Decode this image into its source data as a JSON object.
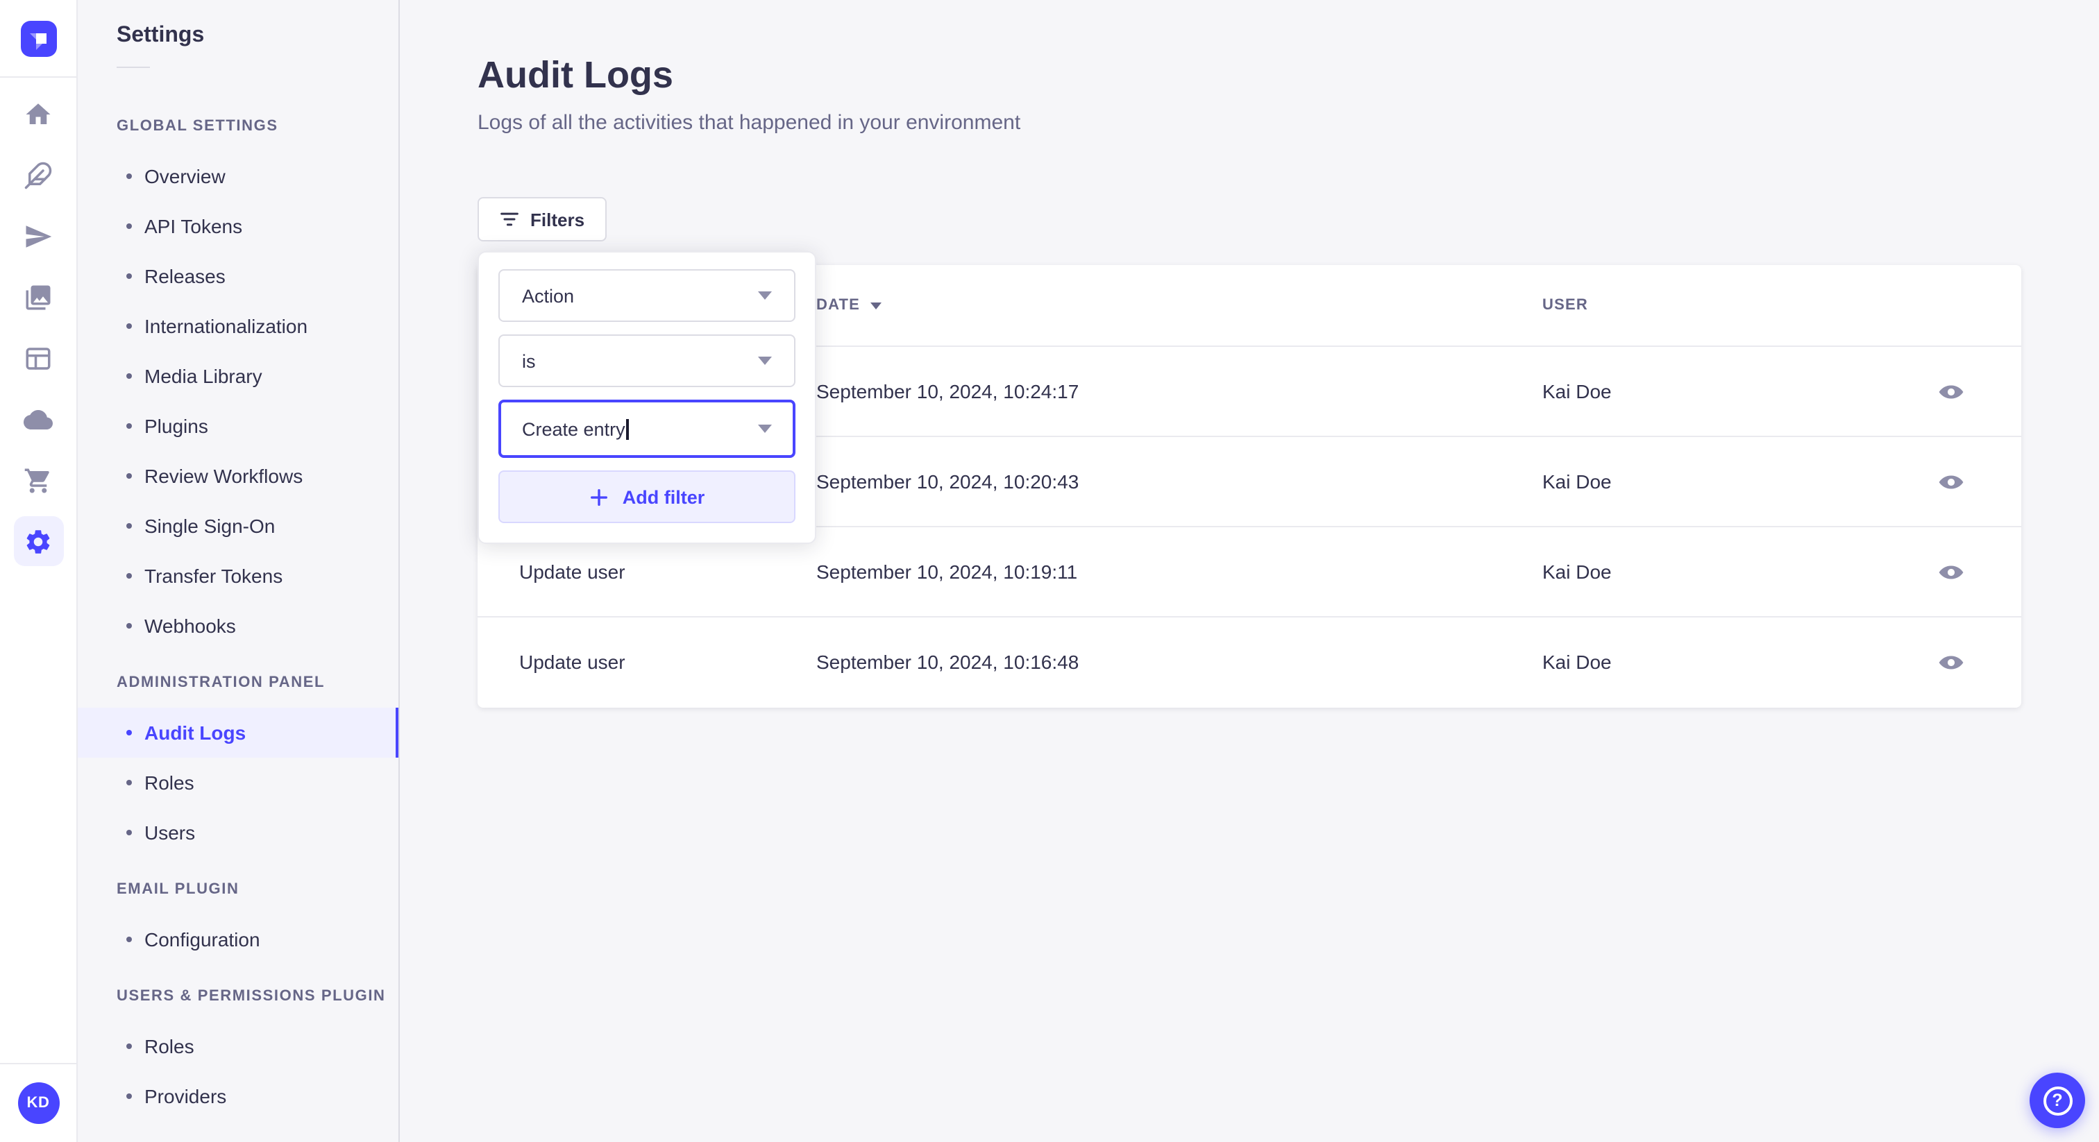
{
  "colors": {
    "primary": "#4945ff",
    "primary_light_bg": "#f0f0ff",
    "text_dark": "#32324d",
    "text_muted": "#666687",
    "icon_gray": "#8e8ea9",
    "border": "#dcdce4",
    "border_light": "#eaeaef",
    "page_bg": "#f6f6f9",
    "card_bg": "#ffffff"
  },
  "rail": {
    "logo_icon": "strapi-logo",
    "items": [
      {
        "icon": "home-icon",
        "active": false
      },
      {
        "icon": "feather-icon",
        "active": false
      },
      {
        "icon": "paper-plane-icon",
        "active": false
      },
      {
        "icon": "media-library-icon",
        "active": false
      },
      {
        "icon": "layout-icon",
        "active": false
      },
      {
        "icon": "cloud-icon",
        "active": false
      },
      {
        "icon": "cart-icon",
        "active": false
      },
      {
        "icon": "gear-icon",
        "active": true
      }
    ],
    "avatar": {
      "initials": "KD"
    }
  },
  "sidebar": {
    "title": "Settings",
    "sections": [
      {
        "label": "GLOBAL SETTINGS",
        "items": [
          {
            "label": "Overview",
            "active": false
          },
          {
            "label": "API Tokens",
            "active": false
          },
          {
            "label": "Releases",
            "active": false
          },
          {
            "label": "Internationalization",
            "active": false
          },
          {
            "label": "Media Library",
            "active": false
          },
          {
            "label": "Plugins",
            "active": false
          },
          {
            "label": "Review Workflows",
            "active": false
          },
          {
            "label": "Single Sign-On",
            "active": false
          },
          {
            "label": "Transfer Tokens",
            "active": false
          },
          {
            "label": "Webhooks",
            "active": false
          }
        ]
      },
      {
        "label": "ADMINISTRATION PANEL",
        "items": [
          {
            "label": "Audit Logs",
            "active": true
          },
          {
            "label": "Roles",
            "active": false
          },
          {
            "label": "Users",
            "active": false
          }
        ]
      },
      {
        "label": "EMAIL PLUGIN",
        "items": [
          {
            "label": "Configuration",
            "active": false
          }
        ]
      },
      {
        "label": "USERS & PERMISSIONS PLUGIN",
        "items": [
          {
            "label": "Roles",
            "active": false
          },
          {
            "label": "Providers",
            "active": false
          }
        ]
      }
    ]
  },
  "main": {
    "title": "Audit Logs",
    "subtitle": "Logs of all the activities that happened in your environment",
    "filters_button": {
      "label": "Filters",
      "icon": "filter-icon"
    }
  },
  "filter_popover": {
    "fields": [
      {
        "value": "Action",
        "icon": "chevron-down-icon",
        "focused": false
      },
      {
        "value": "is",
        "icon": "chevron-down-icon",
        "focused": false
      },
      {
        "value": "Create entry",
        "icon": "chevron-down-icon",
        "focused": true
      }
    ],
    "add_filter_label": "Add filter",
    "add_filter_icon": "plus-icon"
  },
  "table": {
    "columns": [
      {
        "label": "DATE",
        "sort_icon": "caret-down-icon",
        "sorted": "desc"
      },
      {
        "label": "USER",
        "sort_icon": null,
        "sorted": null
      }
    ],
    "row_action_icon": "eye-icon",
    "rows": [
      {
        "action": "",
        "date": "September 10, 2024, 10:24:17",
        "user": "Kai Doe"
      },
      {
        "action": "",
        "date": "September 10, 2024, 10:20:43",
        "user": "Kai Doe"
      },
      {
        "action": "Update user",
        "date": "September 10, 2024, 10:19:11",
        "user": "Kai Doe"
      },
      {
        "action": "Update user",
        "date": "September 10, 2024, 10:16:48",
        "user": "Kai Doe"
      }
    ]
  },
  "help_button": {
    "icon": "question-mark-icon",
    "glyph": "?"
  },
  "avatar_initials": "KD"
}
